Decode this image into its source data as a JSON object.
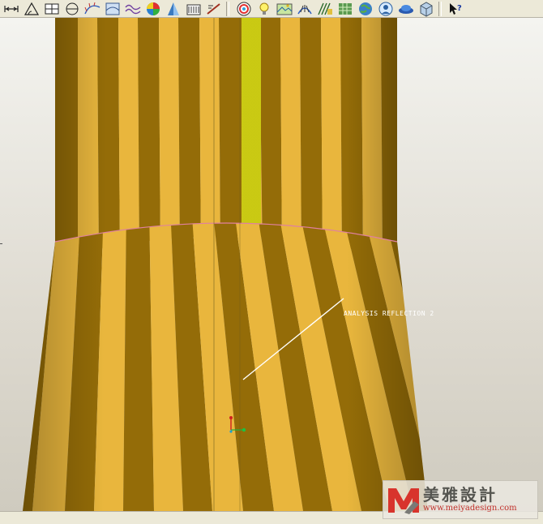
{
  "toolbar": {
    "buttons": [
      {
        "name": "distance-measure-icon"
      },
      {
        "name": "angle-measure-icon"
      },
      {
        "name": "area-measure-icon"
      },
      {
        "name": "diameter-measure-icon"
      },
      {
        "name": "curvature-analysis-icon"
      },
      {
        "name": "section-analysis-icon"
      },
      {
        "name": "offset-curve-icon"
      },
      {
        "name": "gaussian-shade-icon"
      },
      {
        "name": "draft-check-icon"
      },
      {
        "name": "dihedral-angle-icon"
      },
      {
        "name": "deviation-analysis-icon"
      },
      {
        "name": "sep"
      },
      {
        "name": "color-wheel-icon"
      },
      {
        "name": "light-bulb-icon"
      },
      {
        "name": "scene-icon"
      },
      {
        "name": "reflection-analysis-icon"
      },
      {
        "name": "highlight-lines-icon"
      },
      {
        "name": "surface-mesh-icon"
      },
      {
        "name": "globe-icon"
      },
      {
        "name": "portrait-icon"
      },
      {
        "name": "dish-icon"
      },
      {
        "name": "cube-icon"
      },
      {
        "name": "sep"
      },
      {
        "name": "whats-this-help-icon"
      }
    ]
  },
  "viewport": {
    "analysis_note": "ANALYSIS REFLECTION 2",
    "colors": {
      "stripe_light": "#f5c040",
      "stripe_dark": "#9c7208",
      "highlight": "#d4d414",
      "boundary_curve": "#e080a0",
      "background": "#dedad0"
    }
  },
  "watermark": {
    "title": "美雅設計",
    "url": "www.meiyadesign.com"
  }
}
